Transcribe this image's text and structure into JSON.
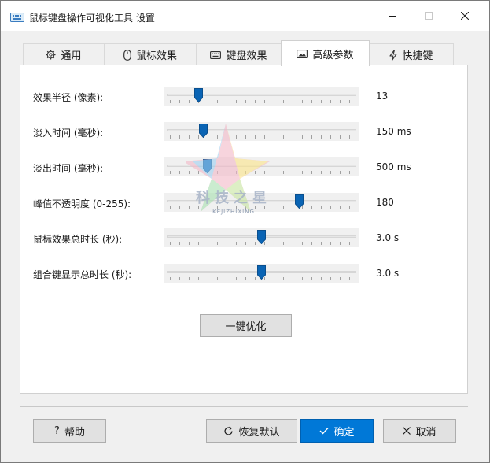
{
  "window": {
    "title": "鼠标键盘操作可视化工具 设置"
  },
  "tabs": [
    {
      "label": "通用",
      "icon": "gear-icon"
    },
    {
      "label": "鼠标效果",
      "icon": "mouse-icon"
    },
    {
      "label": "键盘效果",
      "icon": "keyboard-icon"
    },
    {
      "label": "高级参数",
      "icon": "image-icon",
      "active": true
    },
    {
      "label": "快捷键",
      "icon": "lightning-icon"
    }
  ],
  "params": [
    {
      "label": "效果半径 (像素):",
      "value_text": "13",
      "level": 0.15
    },
    {
      "label": "淡入时间 (毫秒):",
      "value_text": "150 ms",
      "level": 0.18
    },
    {
      "label": "淡出时间 (毫秒):",
      "value_text": "500 ms",
      "level": 0.2
    },
    {
      "label": "峰值不透明度 (0-255):",
      "value_text": "180",
      "level": 0.71
    },
    {
      "label": "鼠标效果总时长 (秒):",
      "value_text": "3.0 s",
      "level": 0.5
    },
    {
      "label": "组合键显示总时长 (秒):",
      "value_text": "3.0 s",
      "level": 0.5
    }
  ],
  "optimize_label": "一键优化",
  "watermark": {
    "text": "科技之星",
    "sub": "KEJIZHIXING"
  },
  "buttons": {
    "help": "帮助",
    "restore": "恢复默认",
    "ok": "确定",
    "cancel": "取消"
  },
  "colors": {
    "accent": "#0078d7",
    "thumb": "#0a64b4"
  }
}
